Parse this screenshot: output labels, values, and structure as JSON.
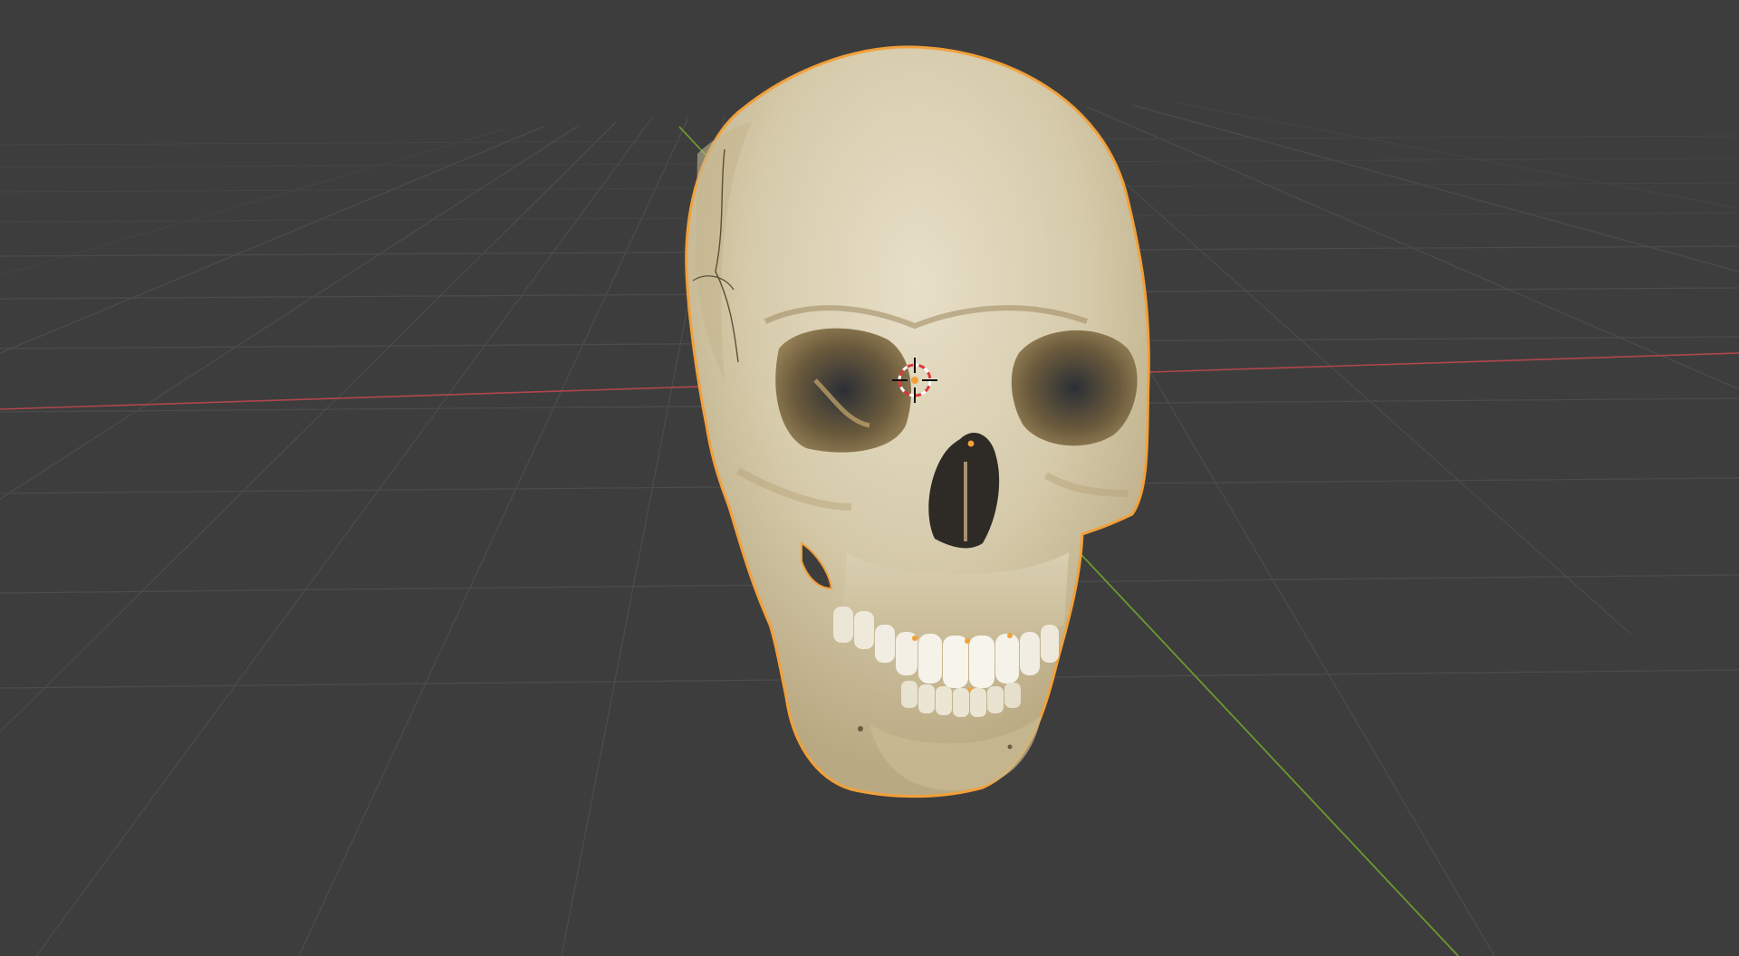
{
  "viewport": {
    "background": "#3d3d3d",
    "grid_color": "#4b4b4b",
    "x_axis_color": "#b0464c",
    "y_axis_color": "#6a9a2e"
  },
  "scene": {
    "selected_object": "skull mesh",
    "selection_outline_color": "#f2a03a",
    "bone_color": "#d9cfb4",
    "icons": [
      "3d-cursor-icon",
      "object-origin-icon"
    ]
  }
}
